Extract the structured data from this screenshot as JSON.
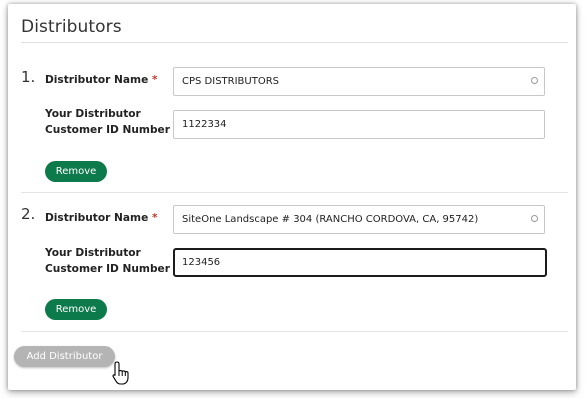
{
  "section": {
    "title": "Distributors"
  },
  "distributors": [
    {
      "number": "1.",
      "name_label": "Distributor Name",
      "name_value": "CPS DISTRIBUTORS",
      "id_label_line1": "Your Distributor",
      "id_label_line2": "Customer ID Number",
      "id_value": "1122334",
      "remove_label": "Remove"
    },
    {
      "number": "2.",
      "name_label": "Distributor Name",
      "name_value": "SiteOne Landscape # 304 (RANCHO CORDOVA, CA, 95742)",
      "id_label_line1": "Your Distributor",
      "id_label_line2": "Customer ID Number",
      "id_value": "123456",
      "remove_label": "Remove"
    }
  ],
  "required_marker": "*",
  "add_button_label": "Add Distributor",
  "colors": {
    "remove_button": "#0c7a4a",
    "add_button": "#b4b4b4",
    "required": "#c0392b"
  },
  "icons": {
    "select": "circle-icon",
    "cursor": "hand-pointer-icon"
  }
}
